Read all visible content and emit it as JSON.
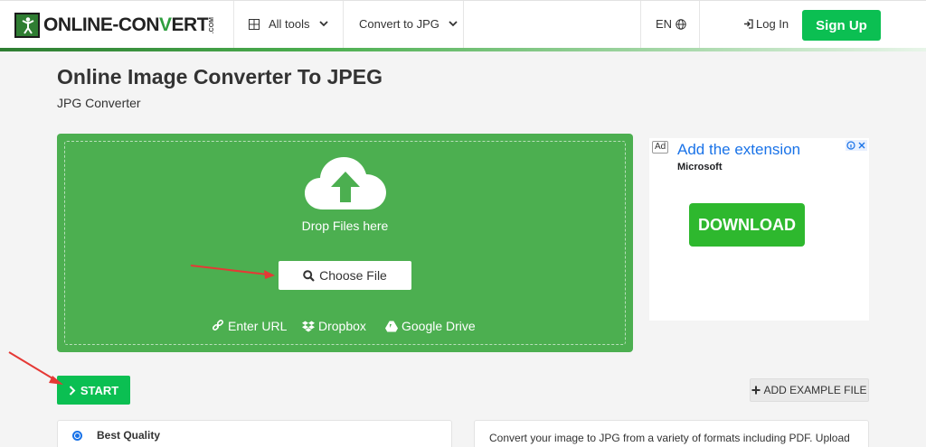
{
  "header": {
    "logo_text_a": "ONLINE-CON",
    "logo_text_v": "V",
    "logo_text_b": "ERT",
    "logo_com": ".COM",
    "all_tools": "All tools",
    "convert_to": "Convert to JPG",
    "language": "EN",
    "login": "Log In",
    "signup": "Sign Up"
  },
  "page": {
    "title": "Online Image Converter To JPEG",
    "subtitle": "JPG Converter"
  },
  "upload": {
    "drop_text": "Drop Files here",
    "choose_file": "Choose File",
    "enter_url": "Enter URL",
    "dropbox": "Dropbox",
    "google_drive": "Google Drive"
  },
  "ad": {
    "badge": "Ad",
    "title": "Add the extension",
    "advertiser": "Microsoft",
    "cta": "DOWNLOAD"
  },
  "actions": {
    "start": "START",
    "add_example": "ADD EXAMPLE FILE"
  },
  "options": {
    "best_quality": "Best Quality",
    "description": "Convert your image to JPG from a variety of formats including PDF. Upload"
  },
  "colors": {
    "brand_green": "#4caf50",
    "button_green": "#0bbf52",
    "annotation_arrow": "#e53935",
    "ad_blue": "#1a73e8"
  }
}
